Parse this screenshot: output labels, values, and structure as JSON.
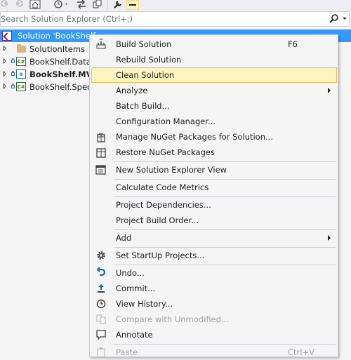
{
  "toolbar": {
    "icons": [
      "back-icon",
      "forward-icon",
      "home-icon",
      "history-icon",
      "sync-icon",
      "pending-changes-icon",
      "properties-icon",
      "preview-icon"
    ]
  },
  "search": {
    "placeholder": "Search Solution Explorer (Ctrl+;)",
    "icon": "search-icon"
  },
  "tree": {
    "solution_label": "Solution 'BookShelf",
    "items": [
      {
        "label": "SolutionItems"
      },
      {
        "label": "BookShelf.DataA"
      },
      {
        "label": "BookShelf.MVC"
      },
      {
        "label": "BookShelf.Specf"
      }
    ]
  },
  "context_menu": {
    "items": {
      "build_solution": {
        "label": "Build Solution",
        "shortcut": "F6"
      },
      "rebuild_solution": {
        "label": "Rebuild Solution"
      },
      "clean_solution": {
        "label": "Clean Solution"
      },
      "analyze": {
        "label": "Analyze"
      },
      "batch_build": {
        "label": "Batch Build..."
      },
      "configuration_manager": {
        "label": "Configuration Manager..."
      },
      "manage_nuget": {
        "label": "Manage NuGet Packages for Solution..."
      },
      "restore_nuget": {
        "label": "Restore NuGet Packages"
      },
      "new_solution_explorer_view": {
        "label": "New Solution Explorer View"
      },
      "calculate_code_metrics": {
        "label": "Calculate Code Metrics"
      },
      "project_dependencies": {
        "label": "Project Dependencies..."
      },
      "project_build_order": {
        "label": "Project Build Order..."
      },
      "add": {
        "label": "Add"
      },
      "set_startup_projects": {
        "label": "Set StartUp Projects..."
      },
      "undo": {
        "label": "Undo..."
      },
      "commit": {
        "label": "Commit..."
      },
      "view_history": {
        "label": "View History..."
      },
      "compare_unmodified": {
        "label": "Compare with Unmodified..."
      },
      "annotate": {
        "label": "Annotate"
      },
      "paste": {
        "label": "Paste",
        "shortcut": "Ctrl+V"
      }
    }
  },
  "colors": {
    "selection": "#3399ff",
    "menu_highlight": "#fdf4bf",
    "menu_highlight_border": "#e5c365",
    "menu_background": "#f5f5f5",
    "disabled_text": "#a2a4a5"
  }
}
